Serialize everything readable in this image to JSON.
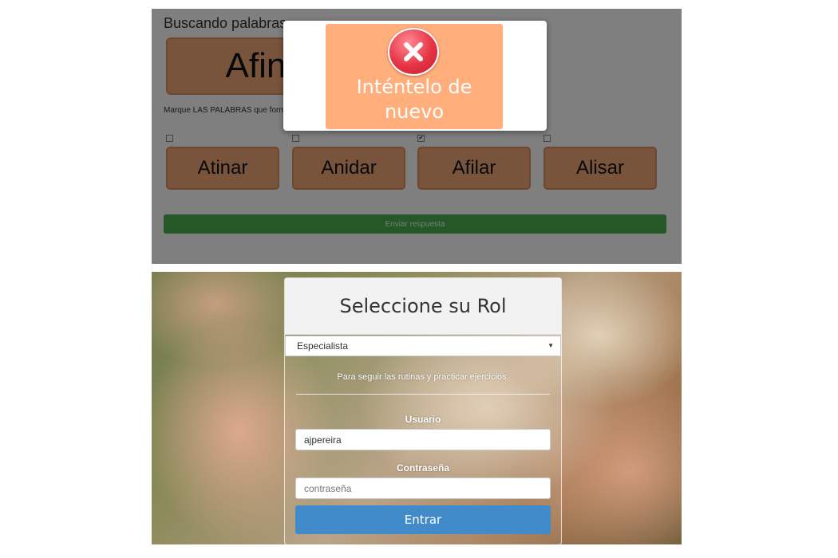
{
  "game_screen": {
    "title": "Buscando palabras",
    "target_word": "Afinar",
    "instructions": "Marque LAS PALABRAS que forman con las letras de la palabra original.",
    "options": [
      {
        "label": "Atinar",
        "checked": false
      },
      {
        "label": "Anidar",
        "checked": false
      },
      {
        "label": "Afilar",
        "checked": true
      },
      {
        "label": "Alisar",
        "checked": false
      }
    ],
    "submit_label": "Enviar respuesta",
    "modal": {
      "message": "Inténtelo de nuevo",
      "icon": "error-x-icon",
      "background_color": "#ffae7c",
      "icon_color": "#e63445"
    },
    "tile_color": "#f2a879",
    "submit_color": "#4cae4c"
  },
  "login_screen": {
    "heading": "Seleccione su Rol",
    "role_selected": "Especialista",
    "role_description": "Para seguir las rutinas y practicar ejercicios.",
    "username_label": "Usuario",
    "username_value": "ajpereira",
    "password_label": "Contraseña",
    "password_placeholder": "contraseña",
    "submit_label": "Entrar",
    "submit_color": "#428bca"
  }
}
